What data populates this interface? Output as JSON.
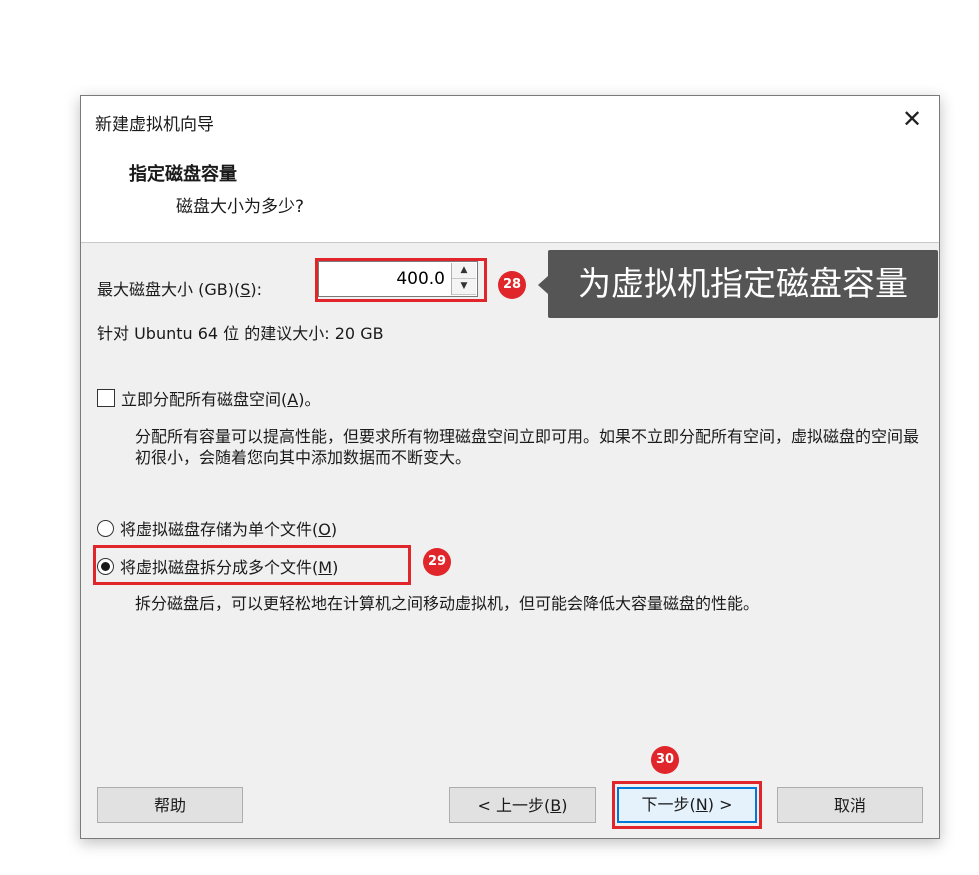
{
  "window": {
    "title": "新建虚拟机向导",
    "close_symbol": "✕"
  },
  "header": {
    "heading": "指定磁盘容量",
    "subheading": "磁盘大小为多少?"
  },
  "disk_size": {
    "label_prefix": "最大磁盘大小 (GB)(",
    "label_key": "S",
    "label_suffix": "):",
    "value": "400.0",
    "spin_up": "▲",
    "spin_down": "▼"
  },
  "recommend": "针对 Ubuntu 64 位 的建议大小: 20 GB",
  "allocate": {
    "label_prefix": "立即分配所有磁盘空间(",
    "label_key": "A",
    "label_suffix": ")。",
    "checked": false,
    "description": "分配所有容量可以提高性能，但要求所有物理磁盘空间立即可用。如果不立即分配所有空间，虚拟磁盘的空间最初很小，会随着您向其中添加数据而不断变大。"
  },
  "store_single": {
    "label_prefix": "将虚拟磁盘存储为单个文件(",
    "label_key": "O",
    "label_suffix": ")",
    "selected": false
  },
  "split_multiple": {
    "label_prefix": "将虚拟磁盘拆分成多个文件(",
    "label_key": "M",
    "label_suffix": ")",
    "selected": true,
    "description": "拆分磁盘后，可以更轻松地在计算机之间移动虚拟机，但可能会降低大容量磁盘的性能。"
  },
  "buttons": {
    "help": "帮助",
    "back_prefix": "< 上一步(",
    "back_key": "B",
    "back_suffix": ")",
    "next_prefix": "下一步(",
    "next_key": "N",
    "next_suffix": ") >",
    "cancel": "取消"
  },
  "annotations": {
    "badge_28": "28",
    "badge_29": "29",
    "badge_30": "30",
    "tooltip": "为虚拟机指定磁盘容量",
    "highlight_color": "#e0262a"
  }
}
